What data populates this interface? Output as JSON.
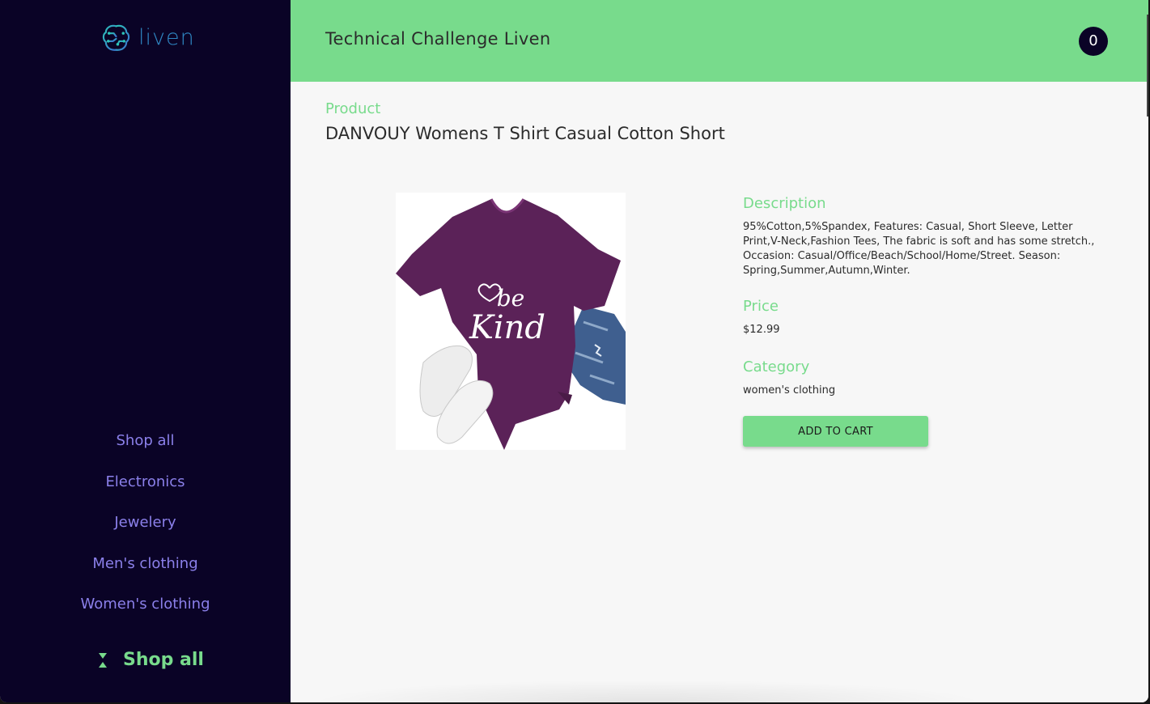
{
  "brand": {
    "logo_text": "liven",
    "logo_icon": "brain-circuit-icon"
  },
  "header": {
    "title": "Technical Challenge Liven",
    "cart_count": "0"
  },
  "sidebar": {
    "items": [
      {
        "label": "Shop all"
      },
      {
        "label": "Electronics"
      },
      {
        "label": "Jewelery"
      },
      {
        "label": "Men's clothing"
      },
      {
        "label": "Women's clothing"
      }
    ],
    "footer_link": {
      "label": "Shop all",
      "icon": "hourglass-icon"
    }
  },
  "product": {
    "kicker": "Product",
    "title": "DANVOUY Womens T Shirt Casual Cotton Short",
    "image_text": "be Kind",
    "description_label": "Description",
    "description": "95%Cotton,5%Spandex, Features: Casual, Short Sleeve, Letter Print,V-Neck,Fashion Tees, The fabric is soft and has some stretch., Occasion: Casual/Office/Beach/School/Home/Street. Season: Spring,Summer,Autumn,Winter.",
    "price_label": "Price",
    "price": "$12.99",
    "category_label": "Category",
    "category": "women's clothing",
    "add_to_cart_label": "ADD TO CART"
  },
  "colors": {
    "sidebar_bg": "#0a0326",
    "accent_green": "#78db8c",
    "nav_text": "#8b80ea",
    "shirt": "#5b2258"
  }
}
